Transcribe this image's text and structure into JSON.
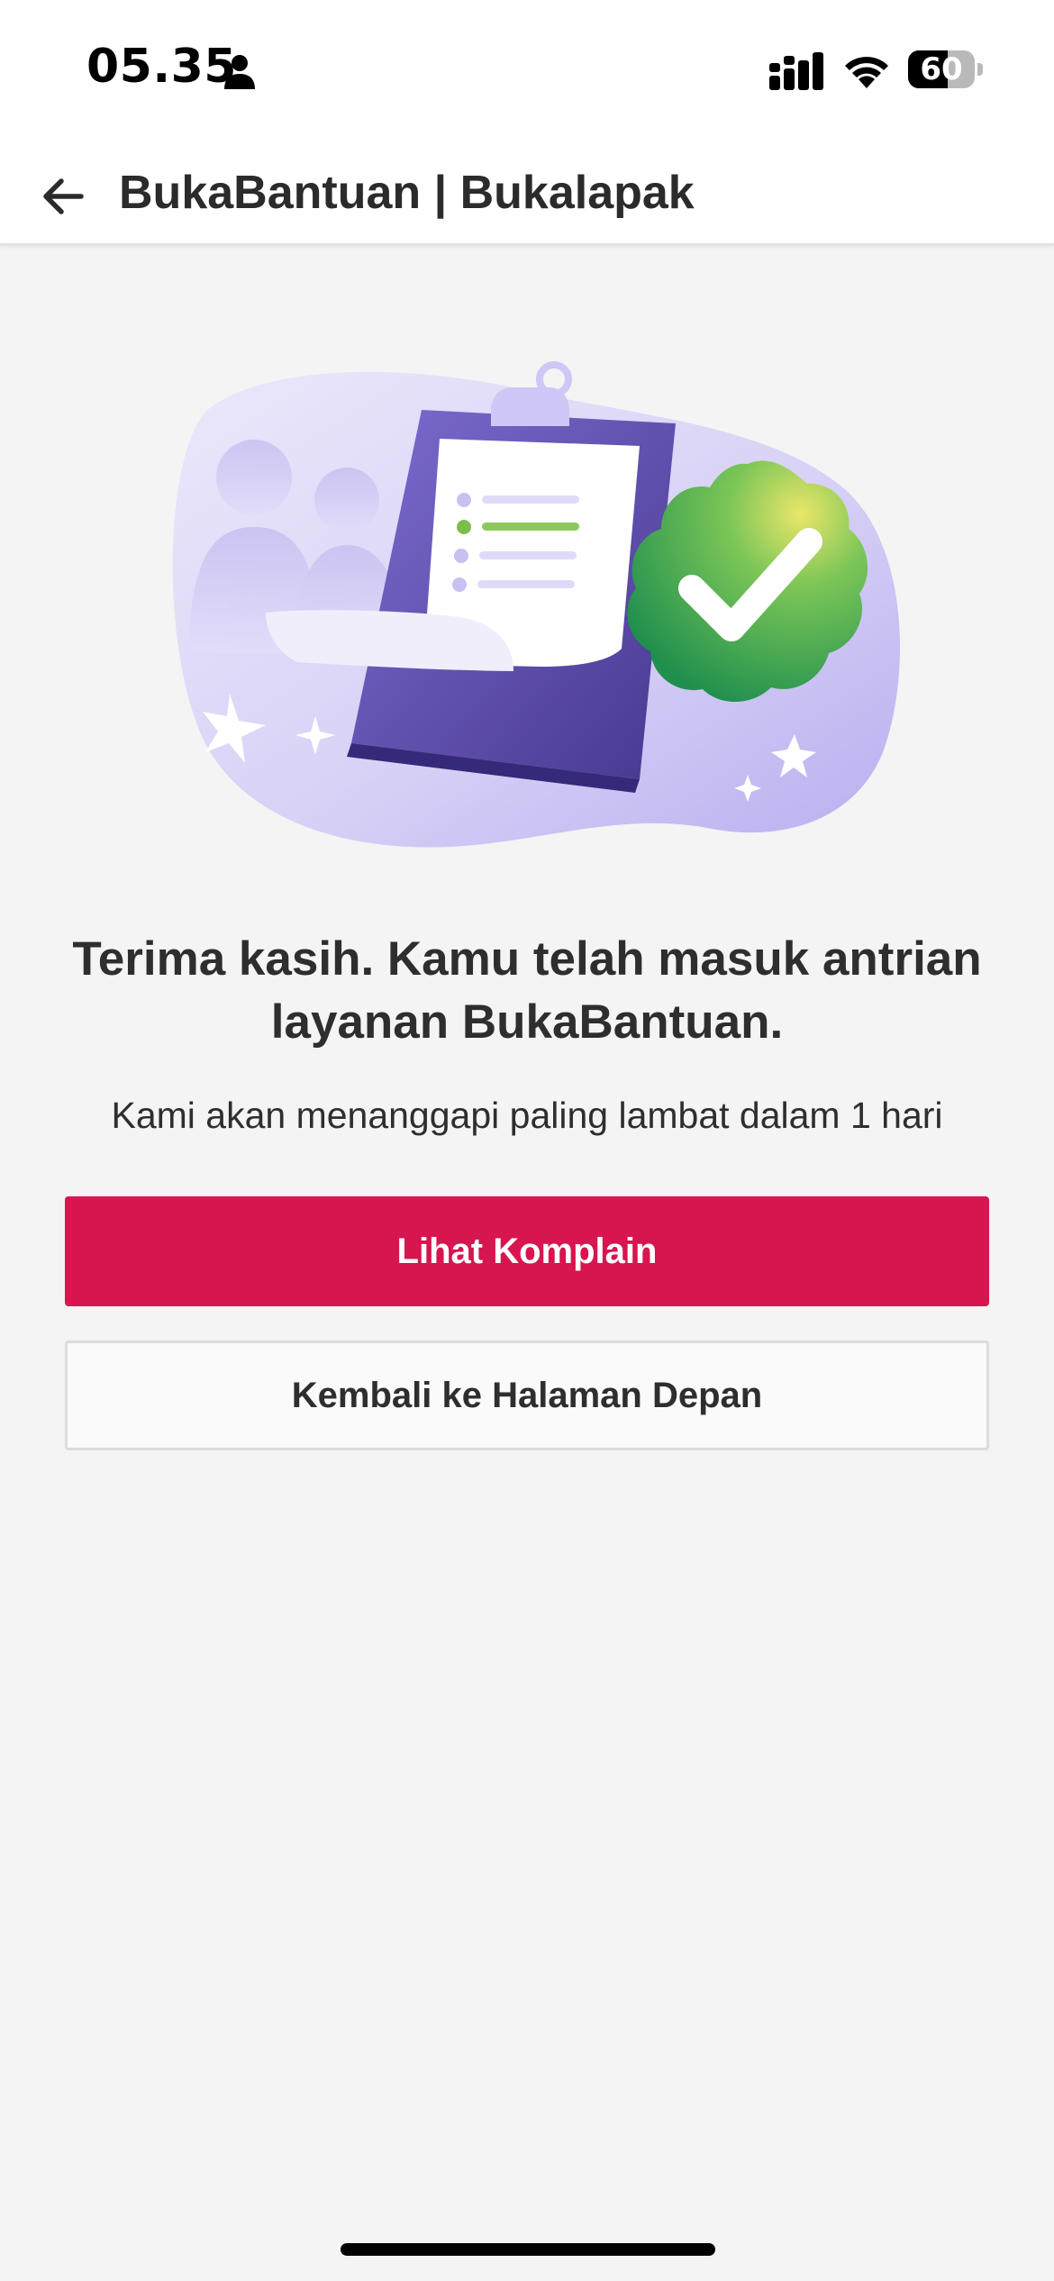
{
  "status_bar": {
    "time": "05.35",
    "battery_level": "60",
    "battery_fraction": 0.6,
    "icons": [
      "person-icon",
      "cellular-signal-icon",
      "wifi-icon",
      "battery-icon"
    ]
  },
  "header": {
    "title": "BukaBantuan | Bukalapak",
    "back_icon": "arrow-left-icon"
  },
  "illustration": {
    "name": "complaint-submitted-illustration",
    "colors": {
      "blob": "#d9d3f7",
      "clipboard": "#5b4aa8",
      "badge": "#3fae5a"
    }
  },
  "message": {
    "headline": "Terima kasih. Kamu telah masuk antrian layanan BukaBantuan.",
    "subtext": "Kami akan menanggapi paling lambat dalam 1 hari"
  },
  "actions": {
    "primary_label": "Lihat Komplain",
    "secondary_label": "Kembali ke Halaman Depan"
  },
  "colors": {
    "primary": "#d7154e",
    "background": "#f4f4f4",
    "text": "#2e2e2e"
  }
}
